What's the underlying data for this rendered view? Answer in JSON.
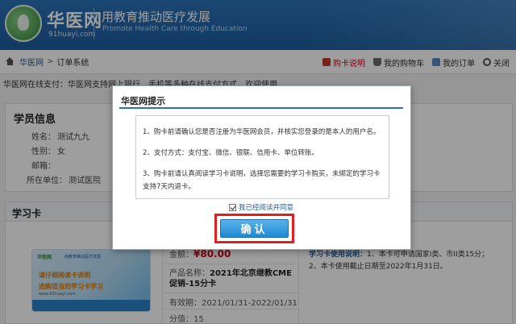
{
  "header": {
    "logo_text": "华医网",
    "logo_sub": "91huayi.com",
    "slogan": "用教育推动医疗发展",
    "slogan_en": "Promote Health Care through Education"
  },
  "breadcrumb": {
    "home": "华医网",
    "separator": ">",
    "current": "订单系统"
  },
  "top_links": {
    "purchase_guide": "购卡说明",
    "my_cart": "我的购物车",
    "my_orders": "我的订单",
    "close": "关闭"
  },
  "notice": "华医网在线支付：华医网支持网上银行、手机等多种在线支付方式，欢迎使用",
  "member": {
    "title": "学员信息",
    "name_label": "姓名：",
    "name": "测试九九",
    "gender_label": "性别：",
    "gender": "女",
    "email_label": "邮箱：",
    "email": "",
    "unit_label": "所在单位：",
    "unit": "测试医院"
  },
  "study_card": {
    "title": "学习卡",
    "image": {
      "brand": "华医网",
      "brand_slogan": "用教育推动医疗发展",
      "line1": "请仔细阅读卡说明",
      "line2": "选购适当的学习卡学习",
      "url": "www.91huayi.com"
    },
    "amount_label": "金额：",
    "amount": "¥80.00",
    "product_label": "产品名称：",
    "product": "2021年北京继教CME促销-15分卡",
    "validity_label": "有效期：",
    "validity": "2021/01/31-2022/01/31",
    "score_label": "分值：",
    "score": "15",
    "usage_title": "学习卡使用说明：",
    "usage_1": "1、本卡可申请国家I类、市II类15分；",
    "usage_2": "2、本卡使用截止日期至2022年1月31日。"
  },
  "modal": {
    "title": "华医网提示",
    "term_1": "1、购卡前请确认您是否注册为华医网会员，并核实您登录的是本人的用户名。",
    "term_2": "2、支付方式：支付宝、微信、银联、信用卡、单位转账。",
    "term_3a": "3、购卡前请认真阅读学习卡说明，选择您需要的学习卡购买，未绑定的学习卡",
    "term_3b": "支持7天内退卡。",
    "agree_label": "我已经阅读并同意",
    "confirm_label": "确认"
  },
  "colors": {
    "header_blue": "#1d5e9f",
    "price_red": "#d0021b",
    "highlight_red": "#e02020",
    "button_blue": "#1f8ad3"
  }
}
